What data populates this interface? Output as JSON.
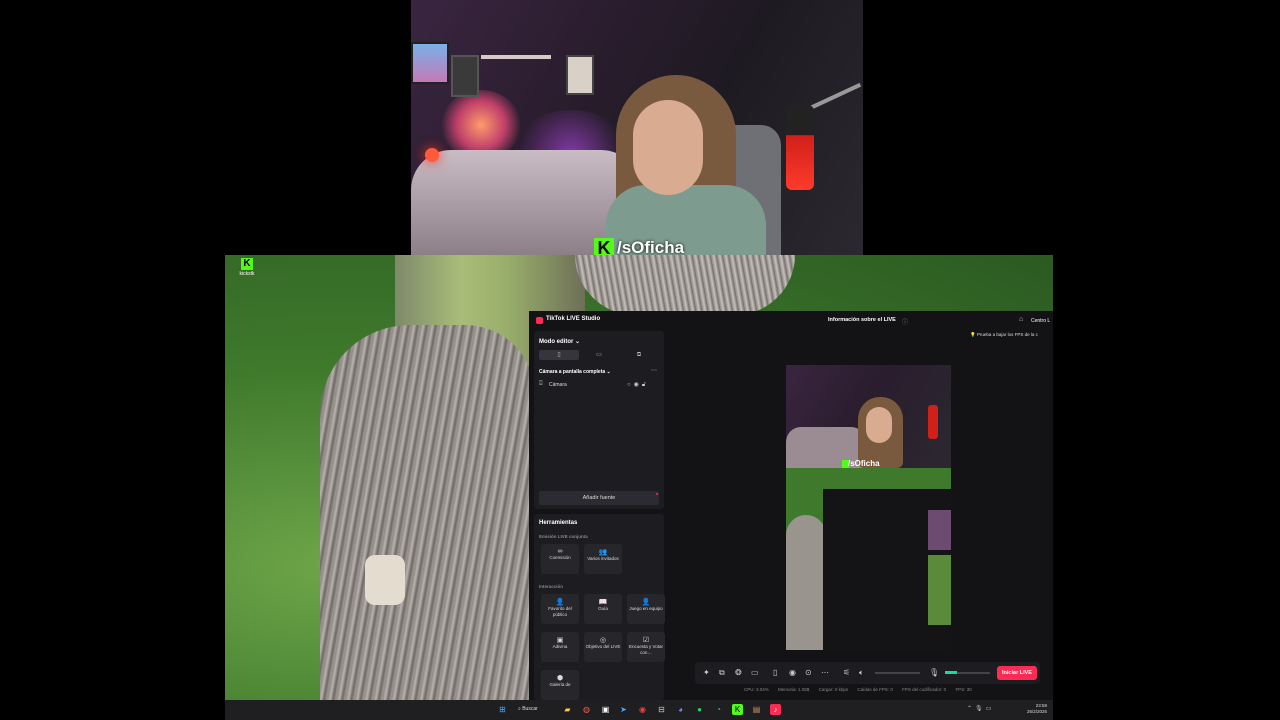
{
  "overlay": {
    "handle": "/sOficha",
    "kick_logo_letter": "K"
  },
  "desktop_icon": {
    "label": "kickstk"
  },
  "studio": {
    "app_title": "TikTok LIVE Studio",
    "live_info": "Información sobre el LIVE",
    "help_center": "Centro L",
    "tip": "Prueba a bajar los FPS de la c",
    "editor_mode": "Modo editor",
    "scene_name": "Cámara a pantalla completa",
    "sources": [
      {
        "label": "Cámara"
      }
    ],
    "add_source": "Añadir fuente",
    "tools_title": "Herramientas",
    "joint_title": "Emisión LIVE conjunta",
    "interaction_title": "Interacción",
    "joint_tools": [
      {
        "icon": "∞",
        "label": "Coemisión"
      },
      {
        "icon": "👥",
        "label": "Varios invitados"
      }
    ],
    "interaction_tools": [
      {
        "icon": "👤",
        "label": "Favorito del público"
      },
      {
        "icon": "📖",
        "label": "Guía"
      },
      {
        "icon": "👤",
        "label": "Juego en equipo"
      },
      {
        "icon": "▣",
        "label": "Adivina"
      },
      {
        "icon": "◎",
        "label": "Objetivo del LIVE"
      },
      {
        "icon": "☑",
        "label": "Encuesta y Votar con…"
      },
      {
        "icon": "⬢",
        "label": "Galería de"
      }
    ],
    "preview_handle": "/sOficha",
    "start_live": "Iniciar LIVE",
    "status": [
      "CPU: 3.04%",
      "Memoria: 1.08$",
      "Cargar: 0 kbps",
      "Caídas de FPS: 0",
      "FPS del codificador: 0",
      "FPS: 30"
    ]
  },
  "taskbar": {
    "search_label": "Buscar",
    "time": "23:59",
    "date": "26/2/2026"
  },
  "colors": {
    "kick_green": "#53fc18",
    "tiktok_pink": "#fe2c55",
    "studio_bg": "#131316",
    "panel_bg": "#1d1d21"
  }
}
